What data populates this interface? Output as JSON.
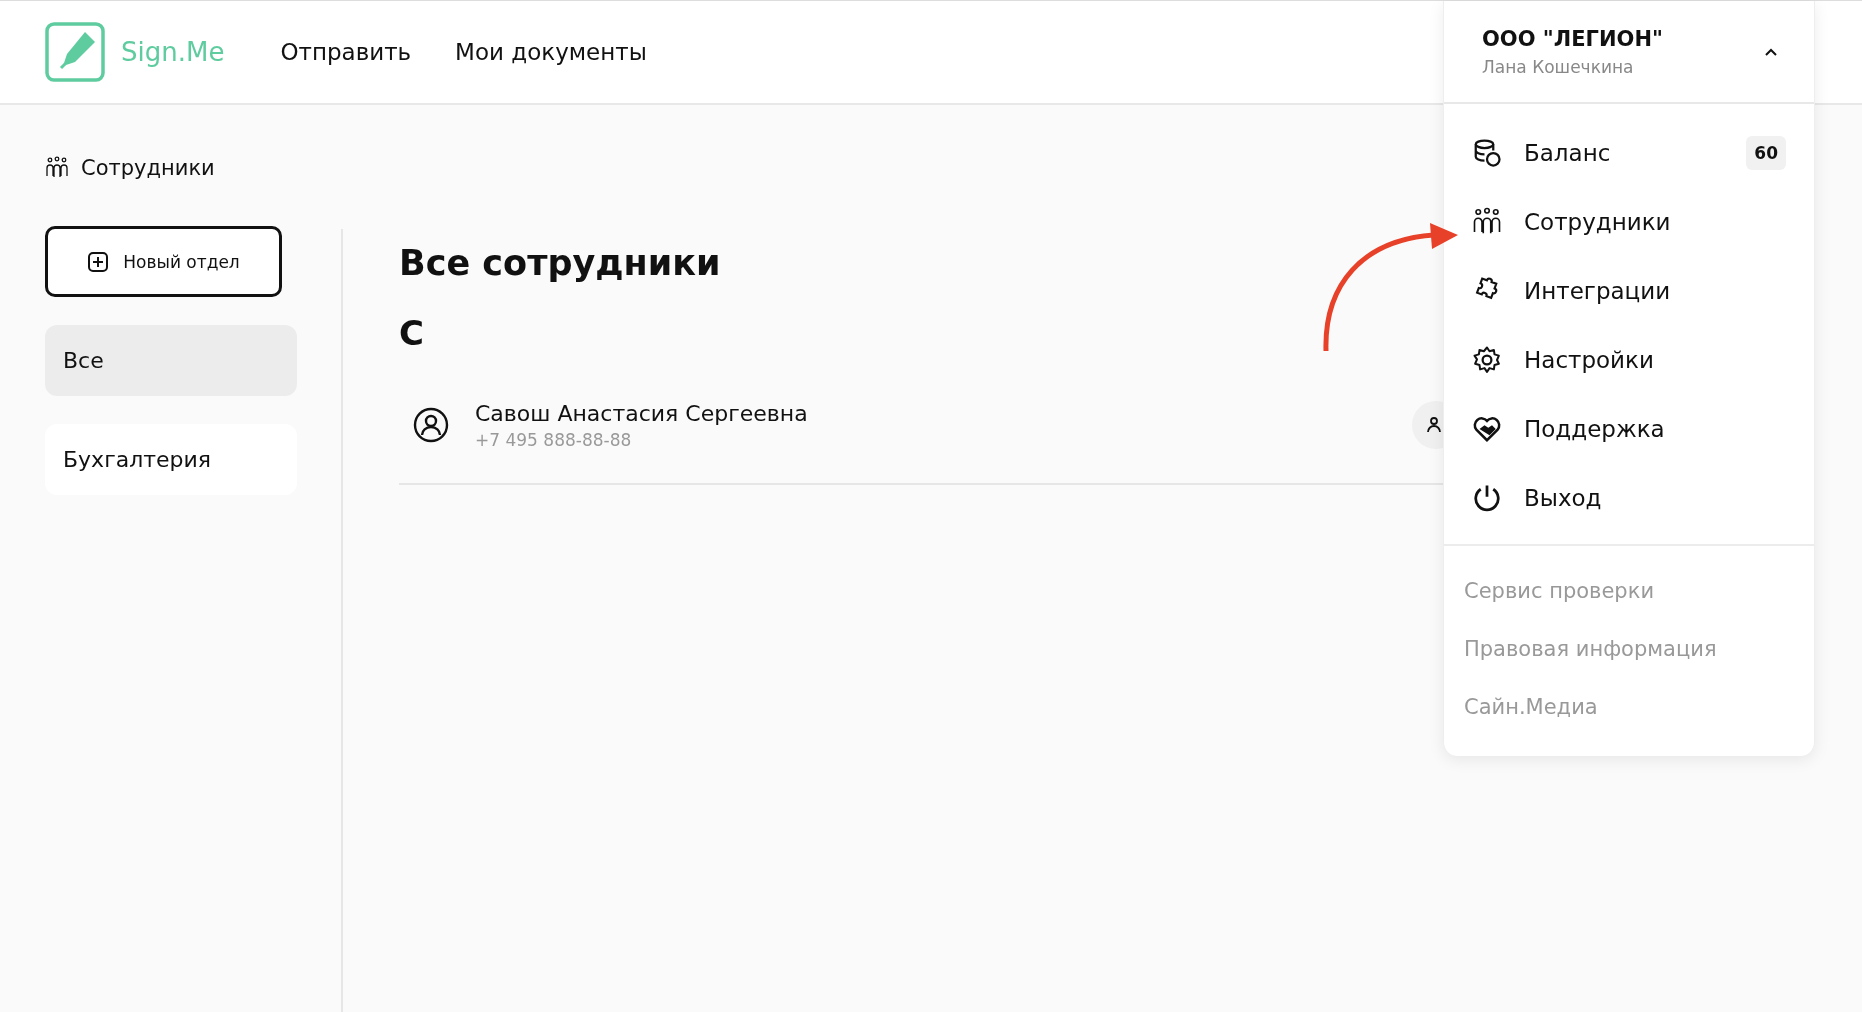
{
  "header": {
    "logo": "Sign.Me",
    "nav": [
      "Отправить",
      "Мои документы"
    ]
  },
  "sidebar": {
    "title": "Сотрудники",
    "new_button": "Новый отдел",
    "departments": [
      {
        "label": "Все",
        "selected": true
      },
      {
        "label": "Бухгалтерия",
        "selected": false
      }
    ]
  },
  "content": {
    "title": "Все сотрудники",
    "groups": [
      {
        "letter": "С",
        "employees": [
          {
            "name": "Савош Анастасия Сергеевна",
            "phone": "+7 495 888-88-88"
          }
        ]
      }
    ]
  },
  "account_menu": {
    "company": "ООО \"ЛЕГИОН\"",
    "user": "Лана Кошечкина",
    "expanded": true,
    "items": [
      {
        "kind": "balance",
        "label": "Баланс",
        "badge": "60"
      },
      {
        "kind": "employees",
        "label": "Сотрудники"
      },
      {
        "kind": "integrations",
        "label": "Интеграции"
      },
      {
        "kind": "settings",
        "label": "Настройки"
      },
      {
        "kind": "support",
        "label": "Поддержка"
      },
      {
        "kind": "logout",
        "label": "Выход"
      }
    ],
    "links": [
      "Сервис проверки",
      "Правовая информация",
      "Сайн.Медиа"
    ]
  }
}
